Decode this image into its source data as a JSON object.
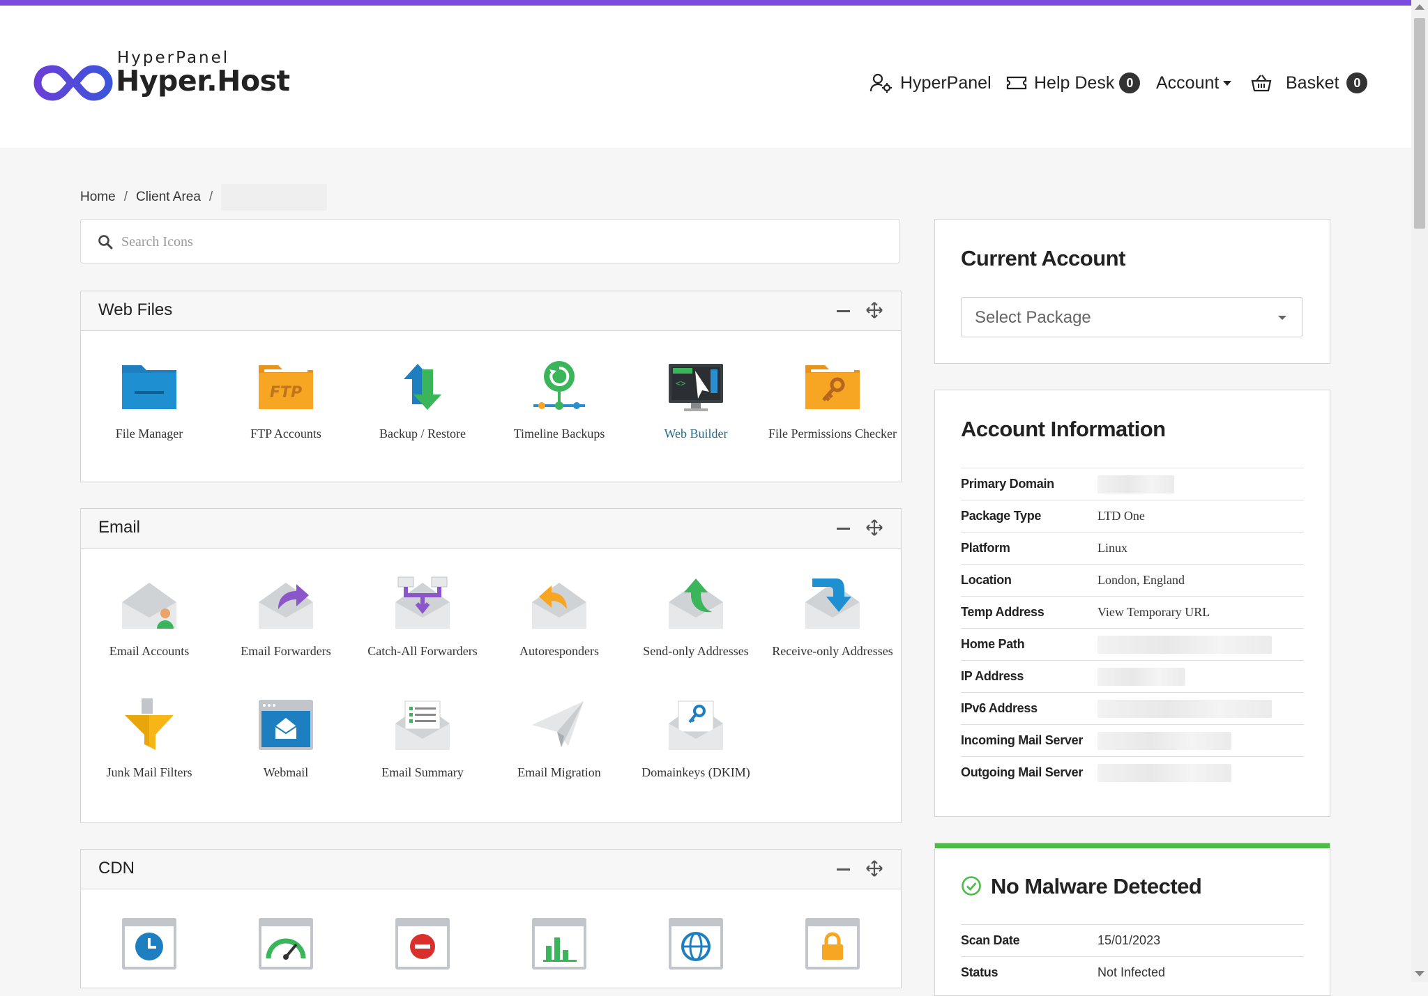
{
  "logo": {
    "sub": "HyperPanel",
    "main": "Hyper.Host"
  },
  "nav": {
    "hyperpanel": "HyperPanel",
    "helpdesk": "Help Desk",
    "helpdesk_count": "0",
    "account": "Account",
    "basket": "Basket",
    "basket_count": "0"
  },
  "breadcrumb": {
    "home": "Home",
    "client_area": "Client Area",
    "sep": "/"
  },
  "search": {
    "placeholder": "Search Icons"
  },
  "panels": {
    "web_files": {
      "title": "Web Files",
      "items": [
        "File Manager",
        "FTP Accounts",
        "Backup / Restore",
        "Timeline Backups",
        "Web Builder",
        "File Permissions Checker"
      ]
    },
    "email": {
      "title": "Email",
      "items": [
        "Email Accounts",
        "Email Forwarders",
        "Catch-All Forwarders",
        "Autoresponders",
        "Send-only Addresses",
        "Receive-only Addresses",
        "Junk Mail Filters",
        "Webmail",
        "Email Summary",
        "Email Migration",
        "Domainkeys (DKIM)"
      ]
    },
    "cdn": {
      "title": "CDN"
    }
  },
  "current_account": {
    "title": "Current Account",
    "select_placeholder": "Select Package"
  },
  "account_info": {
    "title": "Account Information",
    "rows": [
      {
        "label": "Primary Domain",
        "value": ""
      },
      {
        "label": "Package Type",
        "value": "LTD One"
      },
      {
        "label": "Platform",
        "value": "Linux"
      },
      {
        "label": "Location",
        "value": "London, England"
      },
      {
        "label": "Temp Address",
        "value": "View Temporary URL"
      },
      {
        "label": "Home Path",
        "value": ""
      },
      {
        "label": "IP Address",
        "value": ""
      },
      {
        "label": "IPv6 Address",
        "value": ""
      },
      {
        "label": "Incoming Mail Server",
        "value": ""
      },
      {
        "label": "Outgoing Mail Server",
        "value": ""
      }
    ]
  },
  "malware": {
    "title": "No Malware Detected",
    "rows": [
      {
        "label": "Scan Date",
        "value": "15/01/2023"
      },
      {
        "label": "Status",
        "value": "Not Infected"
      }
    ]
  },
  "colors": {
    "accent_bar": "#7b4ddf",
    "logo_blue": "#5a47d8",
    "ok_green": "#4cbb47",
    "folder_blue": "#1e8fd1",
    "folder_orange": "#f6a623"
  }
}
